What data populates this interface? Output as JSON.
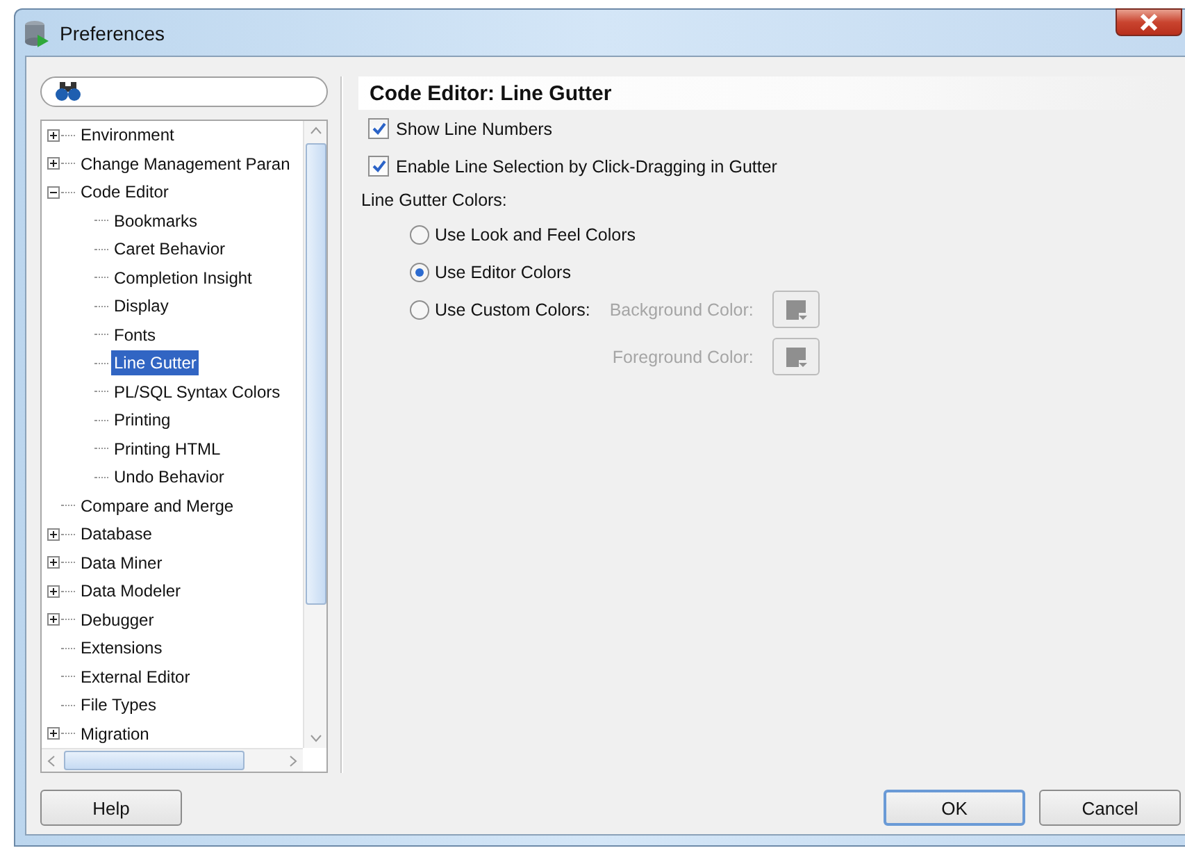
{
  "window": {
    "title": "Preferences"
  },
  "tree": {
    "items": [
      {
        "label": "Environment",
        "expanded": false,
        "selected": false
      },
      {
        "label": "Change Management Paran",
        "expanded": false,
        "selected": false
      },
      {
        "label": "Code Editor",
        "expanded": true,
        "selected": false,
        "children": [
          {
            "label": "Bookmarks",
            "selected": false
          },
          {
            "label": "Caret Behavior",
            "selected": false
          },
          {
            "label": "Completion Insight",
            "selected": false
          },
          {
            "label": "Display",
            "selected": false
          },
          {
            "label": "Fonts",
            "selected": false
          },
          {
            "label": "Line Gutter",
            "selected": true
          },
          {
            "label": "PL/SQL Syntax Colors",
            "selected": false
          },
          {
            "label": "Printing",
            "selected": false
          },
          {
            "label": "Printing HTML",
            "selected": false
          },
          {
            "label": "Undo Behavior",
            "selected": false
          }
        ]
      },
      {
        "label": "Compare and Merge",
        "selected": false
      },
      {
        "label": "Database",
        "expanded": false,
        "selected": false
      },
      {
        "label": "Data Miner",
        "expanded": false,
        "selected": false
      },
      {
        "label": "Data Modeler",
        "expanded": false,
        "selected": false
      },
      {
        "label": "Debugger",
        "expanded": false,
        "selected": false
      },
      {
        "label": "Extensions",
        "selected": false
      },
      {
        "label": "External Editor",
        "selected": false
      },
      {
        "label": "File Types",
        "selected": false
      },
      {
        "label": "Migration",
        "expanded": false,
        "selected": false
      }
    ]
  },
  "panel": {
    "title": "Code Editor: Line Gutter",
    "checkboxes": [
      {
        "label": "Show Line Numbers",
        "checked": true
      },
      {
        "label": "Enable Line Selection by Click-Dragging in Gutter",
        "checked": true
      }
    ],
    "group_label": "Line Gutter Colors:",
    "radios": [
      {
        "label": "Use Look and Feel Colors",
        "selected": false
      },
      {
        "label": "Use Editor Colors",
        "selected": true
      },
      {
        "label": "Use Custom Colors:",
        "selected": false,
        "color_pickers": [
          {
            "label": "Background Color:",
            "disabled": true
          },
          {
            "label": "Foreground Color:",
            "disabled": true
          }
        ]
      }
    ]
  },
  "buttons": [
    {
      "label": "Help",
      "default": false
    },
    {
      "label": "OK",
      "default": true
    },
    {
      "label": "Cancel",
      "default": false
    }
  ]
}
